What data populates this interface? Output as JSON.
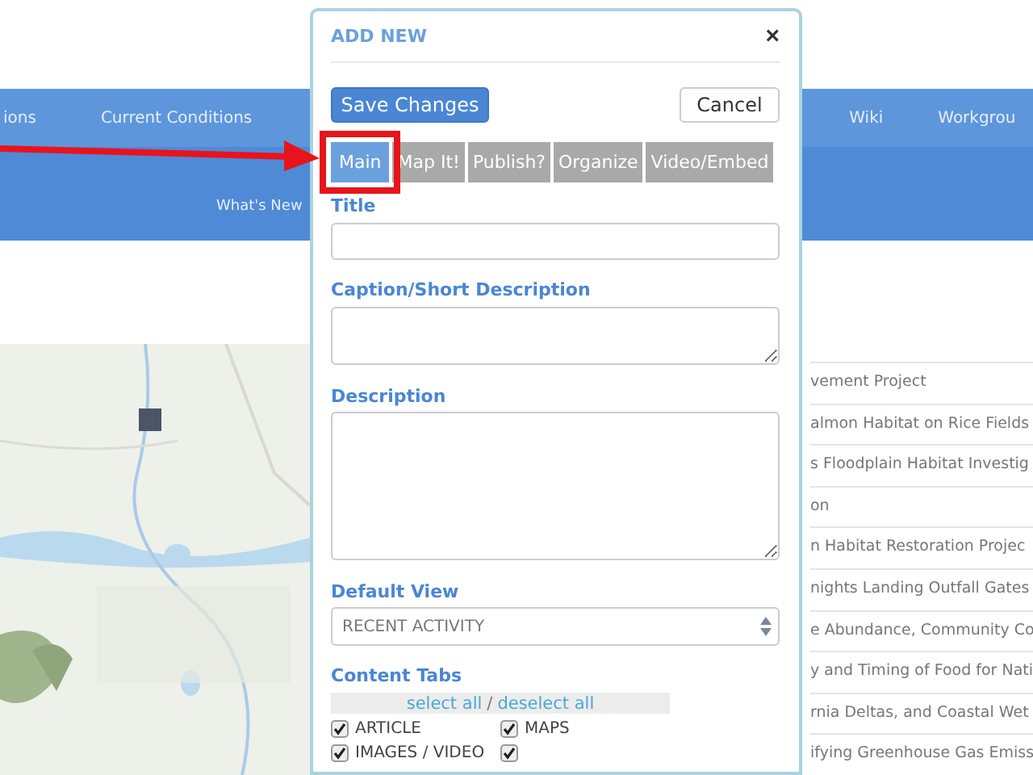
{
  "background": {
    "nav": [
      "ions",
      "Current Conditions",
      "Wiki",
      "Workgrou"
    ],
    "subnav": "What's New",
    "list": [
      "vement Project",
      "almon Habitat on Rice Fields",
      "s Floodplain Habitat Investig",
      "on",
      "n Habitat Restoration Projec",
      "nights Landing Outfall Gates",
      "e Abundance, Community Co",
      "y and Timing of Food for Nati",
      "rnia Deltas, and Coastal Wet",
      "ifying Greenhouse Gas Emiss"
    ]
  },
  "modal": {
    "title": "ADD NEW",
    "close": "×",
    "save_button": "Save Changes",
    "cancel_button": "Cancel",
    "tabs": [
      {
        "label": "Main",
        "selected": true
      },
      {
        "label": "Map It!",
        "selected": false
      },
      {
        "label": "Publish?",
        "selected": false
      },
      {
        "label": "Organize",
        "selected": false
      },
      {
        "label": "Video/Embed",
        "selected": false
      }
    ],
    "fields": [
      {
        "kind": "input",
        "label": "Title"
      },
      {
        "kind": "textarea",
        "label": "Caption/Short Description"
      },
      {
        "kind": "textarea",
        "label": "Description"
      },
      {
        "kind": "select",
        "label": "Default View",
        "value": "RECENT ACTIVITY"
      }
    ],
    "content_tabs": {
      "label": "Content Tabs",
      "select_all": "select all",
      "separator": "/",
      "deselect_all": "deselect all",
      "items": [
        {
          "label": "ARTICLE",
          "checked": true
        },
        {
          "label": "MAPS",
          "checked": true
        },
        {
          "label": "IMAGES / VIDEO",
          "checked": true
        },
        {
          "checked": true
        }
      ]
    }
  }
}
